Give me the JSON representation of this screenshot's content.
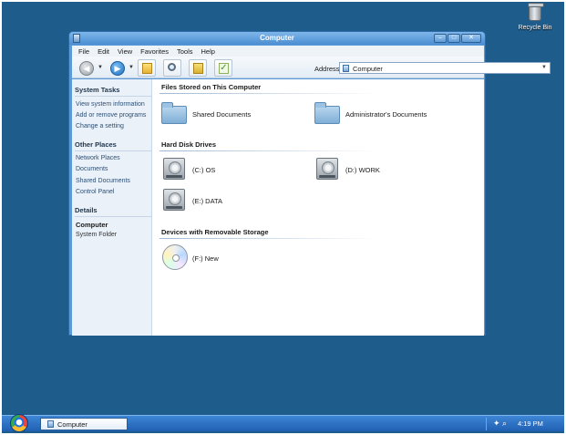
{
  "desktop": {
    "icons": [
      {
        "label": "Recycle Bin",
        "icon": "recycle-bin-icon"
      }
    ],
    "background_color": "#1e5c8c"
  },
  "window": {
    "title": "Computer",
    "menu": [
      "File",
      "Edit",
      "View",
      "Favorites",
      "Tools",
      "Help"
    ],
    "toolbar": {
      "buttons": [
        "back-icon",
        "forward-icon",
        "folder-up-icon",
        "search-icon",
        "favorites-icon",
        "check-icon"
      ]
    },
    "address": {
      "label": "Address",
      "value": "Computer"
    },
    "sidebar": {
      "system_tasks": {
        "title": "System Tasks",
        "items": [
          "View system information",
          "Add or remove programs",
          "Change a setting"
        ]
      },
      "other_places": {
        "title": "Other Places",
        "items": [
          "Network Places",
          "Documents",
          "Shared Documents",
          "Control Panel"
        ]
      },
      "details": {
        "title": "Details",
        "name": "Computer",
        "type": "System Folder"
      }
    },
    "sections": {
      "files": {
        "title": "Files Stored on This Computer",
        "items": [
          "Shared Documents",
          "Administrator's Documents"
        ]
      },
      "hard_disks": {
        "title": "Hard Disk Drives",
        "items": [
          "(C:) OS",
          "(D:) WORK",
          "(E:) DATA"
        ]
      },
      "removable": {
        "title": "Devices with Removable Storage",
        "items": [
          "(F:) New"
        ]
      }
    }
  },
  "taskbar": {
    "button_label": "Computer",
    "time": "4:19 PM",
    "accent": "#2a6cc4"
  }
}
